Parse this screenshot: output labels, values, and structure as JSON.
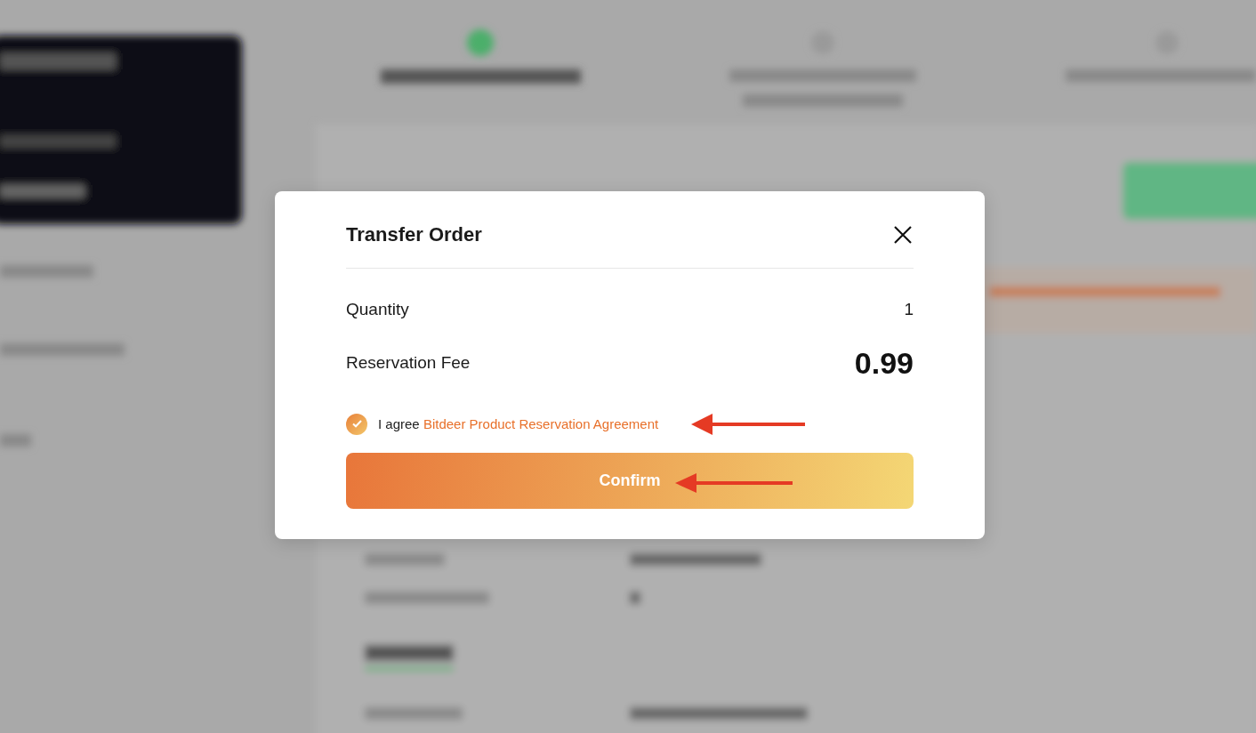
{
  "dialog": {
    "title": "Transfer Order",
    "rows": [
      {
        "label": "Quantity",
        "value": "1",
        "kind": "plain"
      },
      {
        "label": "Reservation Fee",
        "value": "0.99",
        "kind": "large"
      }
    ],
    "agreement": {
      "checked": true,
      "text": "I agree",
      "link": "Bitdeer Product Reservation Agreement"
    },
    "confirm": "Confirm"
  }
}
